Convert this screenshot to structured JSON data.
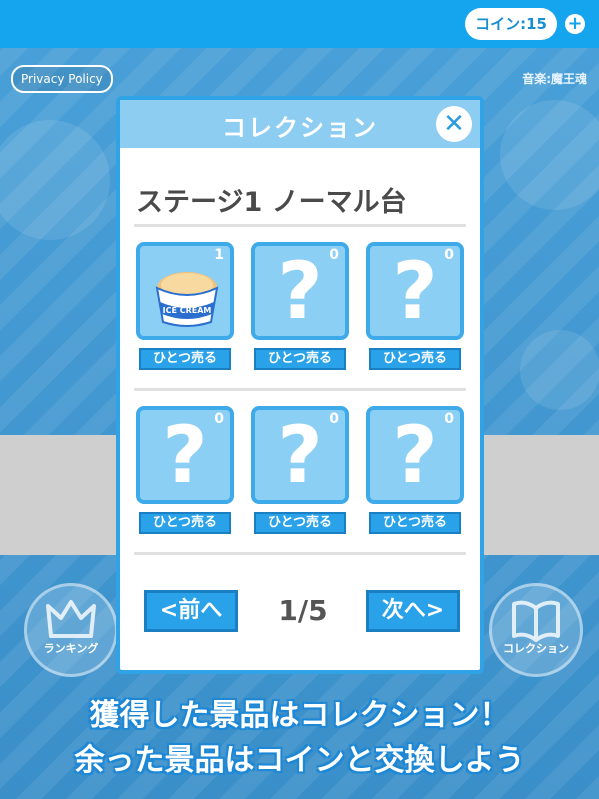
{
  "topbar": {
    "coin_label": "コイン:15",
    "plus_icon": "plus-icon"
  },
  "privacy_label": "Privacy Policy",
  "music_credit": "音楽:魔王魂",
  "side": {
    "ranking_label": "ランキング",
    "collection_label": "コレクション"
  },
  "modal": {
    "title": "コレクション",
    "stage_title": "ステージ1 ノーマル台",
    "items": [
      {
        "count": "1",
        "revealed": true,
        "icon": "ice-cream-icon",
        "image_text": "ICE CREAM",
        "sell_label": "ひとつ売る"
      },
      {
        "count": "0",
        "revealed": false,
        "placeholder": "?",
        "sell_label": "ひとつ売る"
      },
      {
        "count": "0",
        "revealed": false,
        "placeholder": "?",
        "sell_label": "ひとつ売る"
      },
      {
        "count": "0",
        "revealed": false,
        "placeholder": "?",
        "sell_label": "ひとつ売る"
      },
      {
        "count": "0",
        "revealed": false,
        "placeholder": "?",
        "sell_label": "ひとつ売る"
      },
      {
        "count": "0",
        "revealed": false,
        "placeholder": "?",
        "sell_label": "ひとつ売る"
      }
    ],
    "prev_label": "<前へ",
    "next_label": "次へ>",
    "page_indicator": "1/5"
  },
  "promo": {
    "line1": "獲得した景品はコレクション！",
    "line2": "余った景品はコインと交換しよう"
  },
  "colors": {
    "accent": "#15a4ee",
    "card_bg": "#8ccff5",
    "button": "#2aa2ea"
  }
}
